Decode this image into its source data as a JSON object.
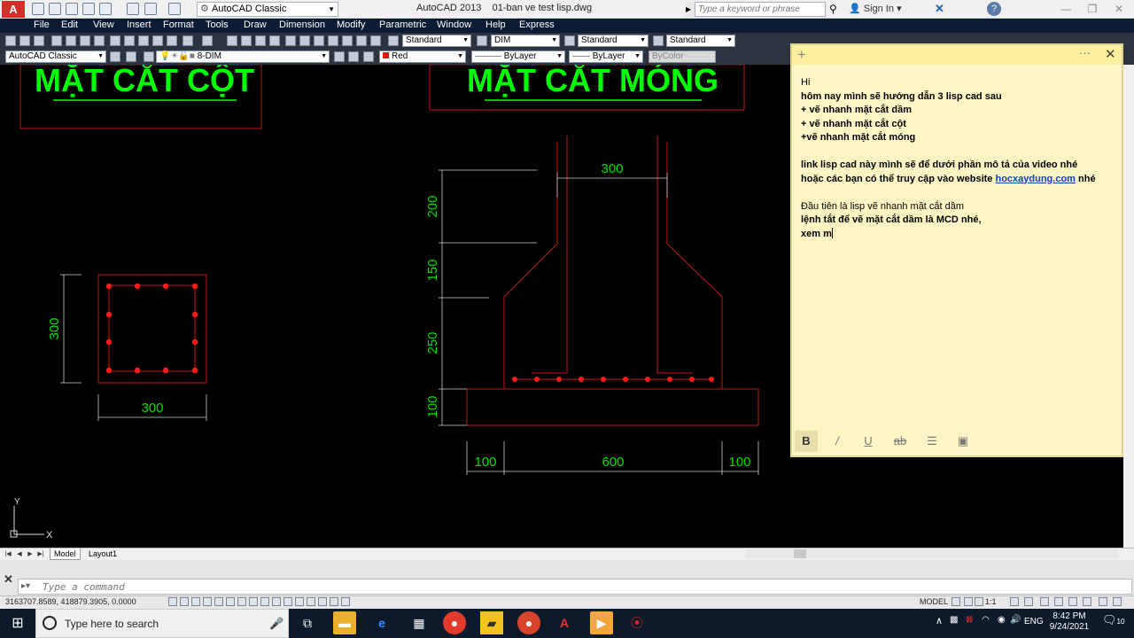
{
  "app": {
    "logo": "A",
    "title": "AutoCAD 2013    01-ban ve test lisp.dwg",
    "workspace": "AutoCAD Classic",
    "search_placeholder": "Type a keyword or phrase",
    "sign_in": "Sign In"
  },
  "menu": [
    "File",
    "Edit",
    "View",
    "Insert",
    "Format",
    "Tools",
    "Draw",
    "Dimension",
    "Modify",
    "Parametric",
    "Window",
    "Help",
    "Express"
  ],
  "toolbar1": {
    "text_style": "Standard",
    "dim_style": "DIM",
    "table_style": "Standard",
    "mleader_style": "Standard"
  },
  "toolbar2": {
    "workspace": "AutoCAD Classic",
    "layer": "8-DIM",
    "color": "Red",
    "linetype": "ByLayer",
    "lineweight": "ByLayer",
    "plotstyle": "ByColor"
  },
  "drawing": {
    "title_column": "MẶT CẮT CỘT",
    "title_footing": "MẶT CẮT MÓNG",
    "col_dim_h": "300",
    "col_dim_w": "300",
    "f_dim_top": "300",
    "f_dim_200": "200",
    "f_dim_150": "150",
    "f_dim_250": "250",
    "f_dim_100v": "100",
    "f_dim_left": "100",
    "f_dim_mid": "600",
    "f_dim_right": "100",
    "ucs_y": "Y",
    "ucs_x": "X"
  },
  "tabs": [
    "Model",
    "Layout1"
  ],
  "command": {
    "placeholder": "Type a command"
  },
  "status": {
    "coords": "3163707.8589, 418879.3905, 0.0000",
    "model": "MODEL",
    "scale": "1:1"
  },
  "note": {
    "lines": [
      {
        "text": "Hi",
        "bold": false
      },
      {
        "text": "hôm nay mình sẽ hướng dẫn 3 lisp cad sau",
        "bold": true
      },
      {
        "text": "+ vẽ nhanh mặt cắt dầm",
        "bold": true
      },
      {
        "text": "+ vẽ nhanh mặt cắt cột",
        "bold": true
      },
      {
        "text": "+vẽ nhanh mặt cắt móng",
        "bold": true
      },
      {
        "text": "",
        "bold": false
      },
      {
        "text": "link lisp cad này mình sẽ để dưới phần mô tả của video nhé",
        "bold": true
      },
      {
        "text": "hoặc các bạn có thể truy cập vào website",
        "bold": true,
        "link": "hocxaydung.com",
        "after": " nhé"
      },
      {
        "text": "",
        "bold": false
      },
      {
        "text": "Đầu tiên là lisp vẽ nhanh mặt cắt dầm",
        "bold": false
      },
      {
        "text": "lệnh tắt để vẽ mặt cắt dầm là MCD nhé,",
        "bold": true
      },
      {
        "text": "xem m",
        "bold": true
      }
    ]
  },
  "taskbar": {
    "search": "Type here to search",
    "lang": "ENG",
    "time": "8:42 PM",
    "date": "9/24/2021",
    "notif_count": "10"
  }
}
